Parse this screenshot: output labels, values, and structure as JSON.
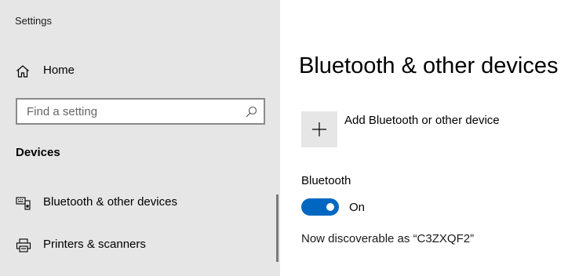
{
  "window": {
    "title": "Settings"
  },
  "sidebar": {
    "home": {
      "label": "Home",
      "icon": "home-icon"
    },
    "search": {
      "placeholder": "Find a setting",
      "value": "",
      "icon": "search-icon"
    },
    "section_heading": "Devices",
    "items": [
      {
        "label": "Bluetooth & other devices",
        "icon": "bluetooth-devices-icon",
        "selected": true
      },
      {
        "label": "Printers & scanners",
        "icon": "printer-icon",
        "selected": false
      }
    ]
  },
  "main": {
    "title": "Bluetooth & other devices",
    "add_device": {
      "label": "Add Bluetooth or other device",
      "icon": "plus-icon"
    },
    "bluetooth": {
      "label": "Bluetooth",
      "state": "On",
      "enabled": true
    },
    "discoverable_text": "Now discoverable as “C3ZXQF2”"
  },
  "colors": {
    "sidebar_bg": "#e6e6e6",
    "accent": "#0067c0",
    "tile_bg": "#e6e6e6"
  }
}
